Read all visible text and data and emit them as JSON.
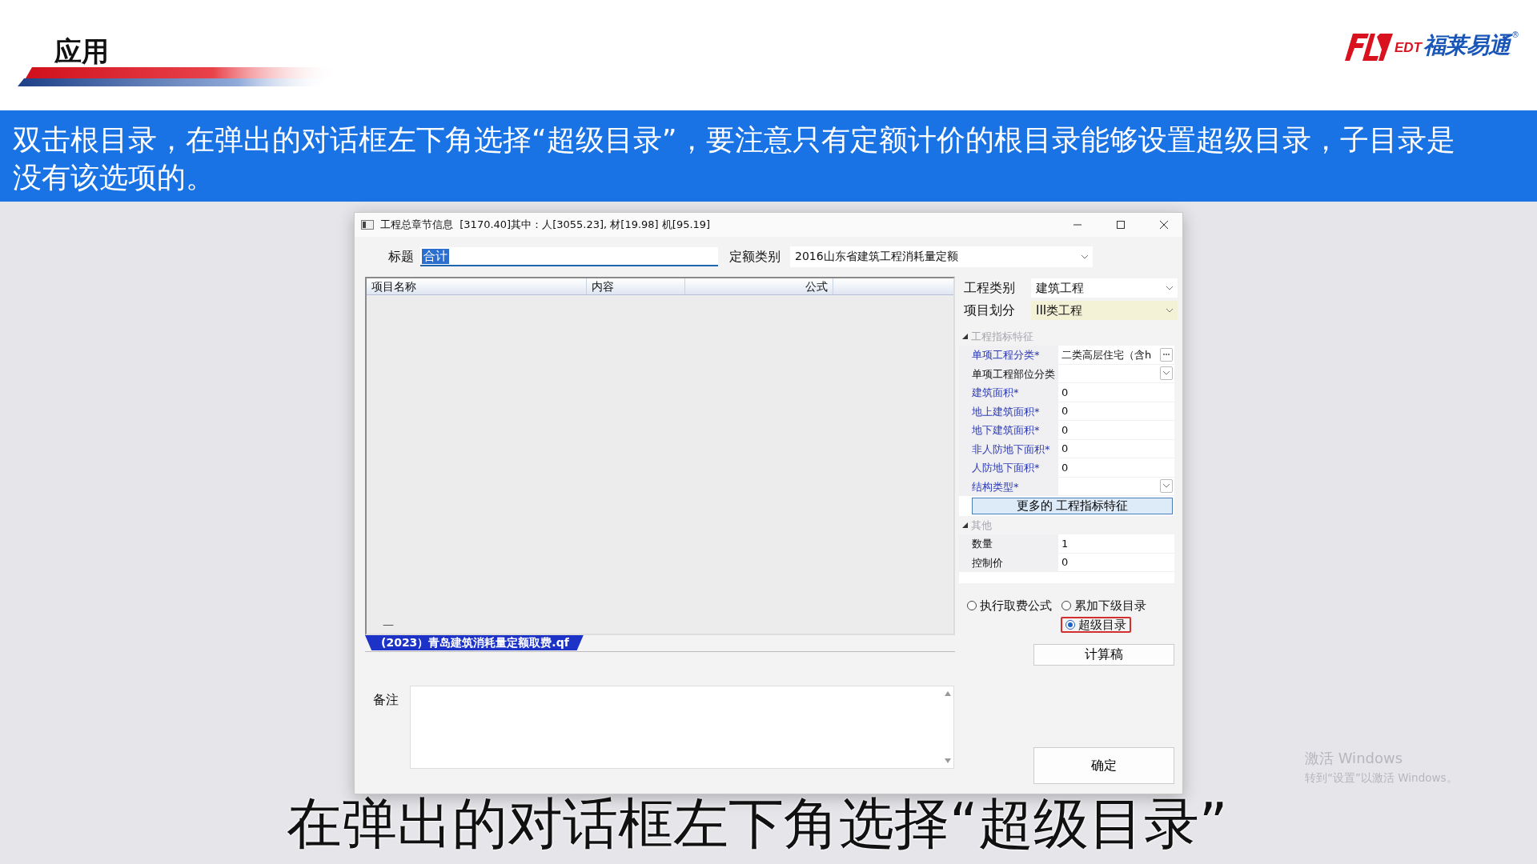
{
  "slide": {
    "heading": "应用",
    "banner": "双击根目录，在弹出的对话框左下角选择“超级目录”，要注意只有定额计价的根目录能够设置超级目录，子目录是没有该选项的。"
  },
  "logo": {
    "latin": "EDT",
    "name": "福莱易通",
    "mark": "®"
  },
  "dialog": {
    "title": "工程总章节信息  [3170.40]其中：人[3055.23], 材[19.98] 机[95.19]",
    "title_field": {
      "label": "标题",
      "value": "合计"
    },
    "quota_type": {
      "label": "定额类别",
      "value": "2016山东省建筑工程消耗量定额"
    },
    "grid": {
      "columns": [
        "项目名称",
        "内容",
        "公式"
      ],
      "row_marker": "—",
      "tabs": [
        {
          "label": "(2023）青岛建筑消耗量定额取费.qf",
          "selected": true
        }
      ]
    },
    "project_category": {
      "label": "工程类别",
      "value": "建筑工程"
    },
    "project_division": {
      "label": "项目划分",
      "value": "III类工程"
    },
    "property_groups": [
      {
        "title": "工程指标特征",
        "expanded": true,
        "rows": [
          {
            "name": "单项工程分类*",
            "value": "二类高层住宅（含h",
            "required": true,
            "kind": "ellipsis"
          },
          {
            "name": "单项工程部位分类",
            "required": false,
            "kind": "dropdown"
          },
          {
            "name": "建筑面积*",
            "value": "0",
            "required": true,
            "kind": "text"
          },
          {
            "name": "地上建筑面积*",
            "value": "0",
            "required": true,
            "kind": "text"
          },
          {
            "name": "地下建筑面积*",
            "value": "0",
            "required": true,
            "kind": "text"
          },
          {
            "name": "非人防地下面积*",
            "value": "0",
            "required": true,
            "kind": "text"
          },
          {
            "name": "人防地下面积*",
            "value": "0",
            "required": true,
            "kind": "text"
          },
          {
            "name": "结构类型*",
            "required": true,
            "kind": "dropdown"
          }
        ],
        "button": "更多的 工程指标特征"
      },
      {
        "title": "其他",
        "expanded": true,
        "rows": [
          {
            "name": "数量",
            "value": "1",
            "required": false,
            "kind": "text"
          },
          {
            "name": "控制价",
            "value": "0",
            "required": false,
            "kind": "text"
          }
        ]
      }
    ],
    "options": [
      {
        "label": "执行取费公式",
        "selected": false,
        "highlighted": false
      },
      {
        "label": "累加下级目录",
        "selected": false,
        "highlighted": false
      },
      {
        "label": "超级目录",
        "selected": true,
        "highlighted": true
      }
    ],
    "calc_button": "计算稿",
    "remarks": {
      "label": "备注"
    },
    "ok_button": "确定"
  },
  "os_notice": {
    "title": "激活 Windows",
    "text": "转到“设置”以激活 Windows。"
  },
  "subtitle": "在弹出的对话框左下角选择“超级目录”"
}
